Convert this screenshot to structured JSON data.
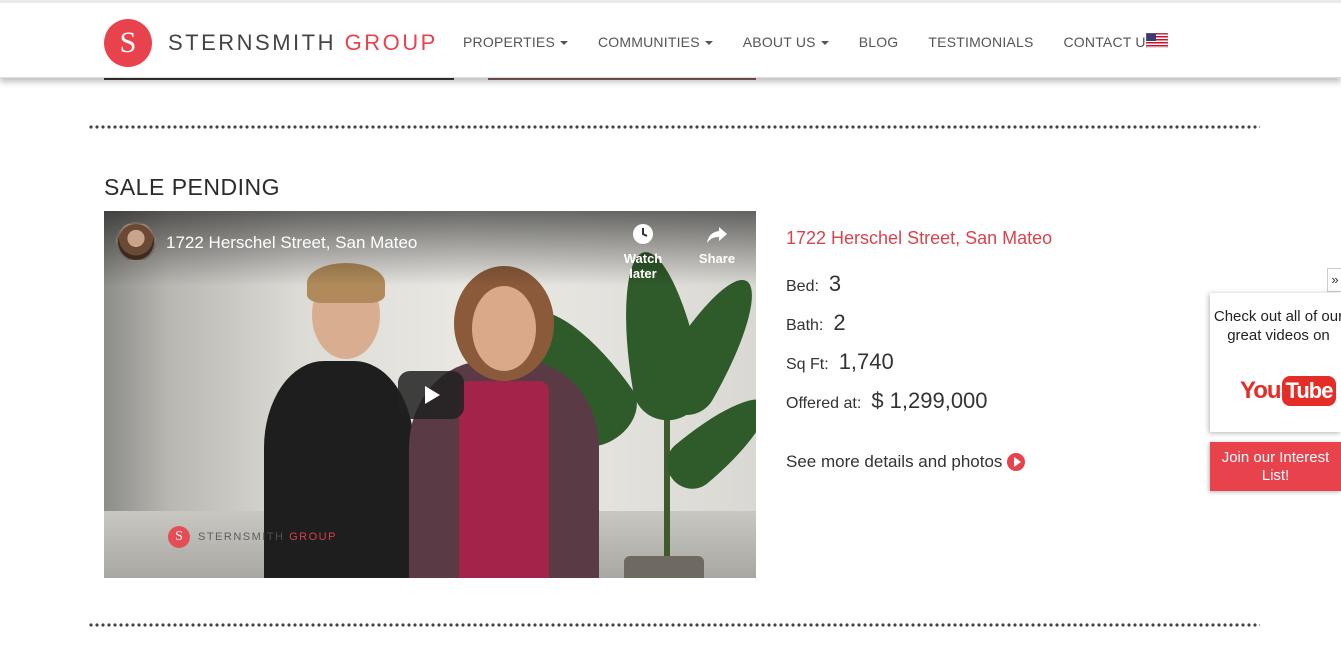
{
  "brand": {
    "logo_letter": "S",
    "name_part1": "STERNSMITH",
    "name_part2": "GROUP"
  },
  "nav": {
    "items": [
      {
        "label": "PROPERTIES",
        "has_dropdown": true
      },
      {
        "label": "COMMUNITIES",
        "has_dropdown": true
      },
      {
        "label": "ABOUT US",
        "has_dropdown": true
      },
      {
        "label": "BLOG",
        "has_dropdown": false
      },
      {
        "label": "TESTIMONIALS",
        "has_dropdown": false
      },
      {
        "label": "CONTACT US",
        "has_dropdown": false
      }
    ],
    "language_icon": "us-flag-icon"
  },
  "listing": {
    "section_title": "SALE PENDING",
    "video": {
      "title": "1722 Herschel Street, San Mateo",
      "watch_later_label": "Watch later",
      "share_label": "Share",
      "watermark_part1": "STERNSMITH",
      "watermark_part2": "GROUP",
      "watermark_letter": "S"
    },
    "address": "1722 Herschel Street, San Mateo",
    "bed_label": "Bed:",
    "bed_value": "3",
    "bath_label": "Bath:",
    "bath_value": "2",
    "sqft_label": "Sq Ft:",
    "sqft_value": "1,740",
    "price_label": "Offered at:",
    "price_value": "$ 1,299,000",
    "more_link": "See more details and photos"
  },
  "sidebar_widget": {
    "collapse_glyph": "»",
    "youtube_promo": "Check out all of our great videos on",
    "youtube_you": "You",
    "youtube_tube": "Tube",
    "interest_button": "Join our Interest List!"
  },
  "colors": {
    "accent": "#e8434c",
    "text": "#333333",
    "youtube_red": "#e52d27"
  }
}
